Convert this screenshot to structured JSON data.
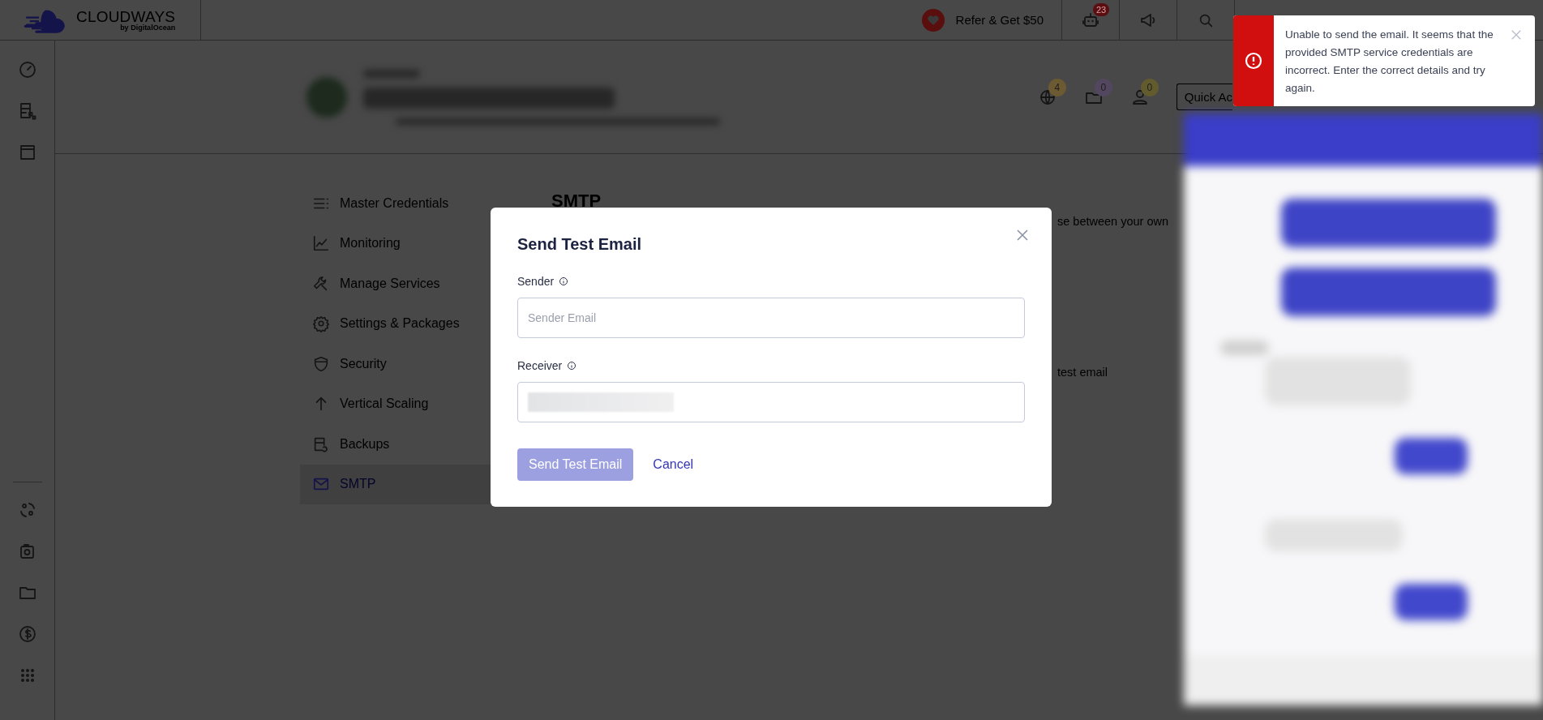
{
  "topbar": {
    "brand": "CLOUDWAYS",
    "brand_sub": "by DigitalOcean",
    "refer": "Refer & Get $50",
    "bot_badge": "23"
  },
  "server_header": {
    "counters": [
      {
        "kind": "www",
        "count": "4",
        "color": "#6b5a32"
      },
      {
        "kind": "folder",
        "count": "0",
        "color": "#52475f"
      },
      {
        "kind": "user",
        "count": "0",
        "color": "#625b2e"
      }
    ],
    "quick_actions": "Quick Ac"
  },
  "menu": {
    "items": [
      {
        "kind": "list",
        "label": "Master Credentials",
        "selected": false
      },
      {
        "kind": "chart",
        "label": "Monitoring",
        "selected": false
      },
      {
        "kind": "wrench",
        "label": "Manage Services",
        "selected": false
      },
      {
        "kind": "gear",
        "label": "Settings & Packages",
        "selected": false
      },
      {
        "kind": "shield",
        "label": "Security",
        "selected": false
      },
      {
        "kind": "arrow",
        "label": "Vertical Scaling",
        "selected": false
      },
      {
        "kind": "backup",
        "label": "Backups",
        "selected": false
      },
      {
        "kind": "mail",
        "label": "SMTP",
        "selected": true
      }
    ]
  },
  "content": {
    "heading": "SMTP",
    "line_1": "se between your own",
    "line_2": "test email"
  },
  "dialog": {
    "title": "Send Test Email",
    "fields": [
      {
        "label": "Sender",
        "placeholder": "Sender Email",
        "redacted": false
      },
      {
        "label": "Receiver",
        "redacted": true
      }
    ],
    "submit": {
      "label": "Send Test Email",
      "disabled": true
    },
    "cancel": "Cancel"
  },
  "toast": {
    "kind": "error",
    "message": "Unable to send the email. It seems that the provided SMTP service credentials are incorrect. Enter the correct details and try again."
  }
}
